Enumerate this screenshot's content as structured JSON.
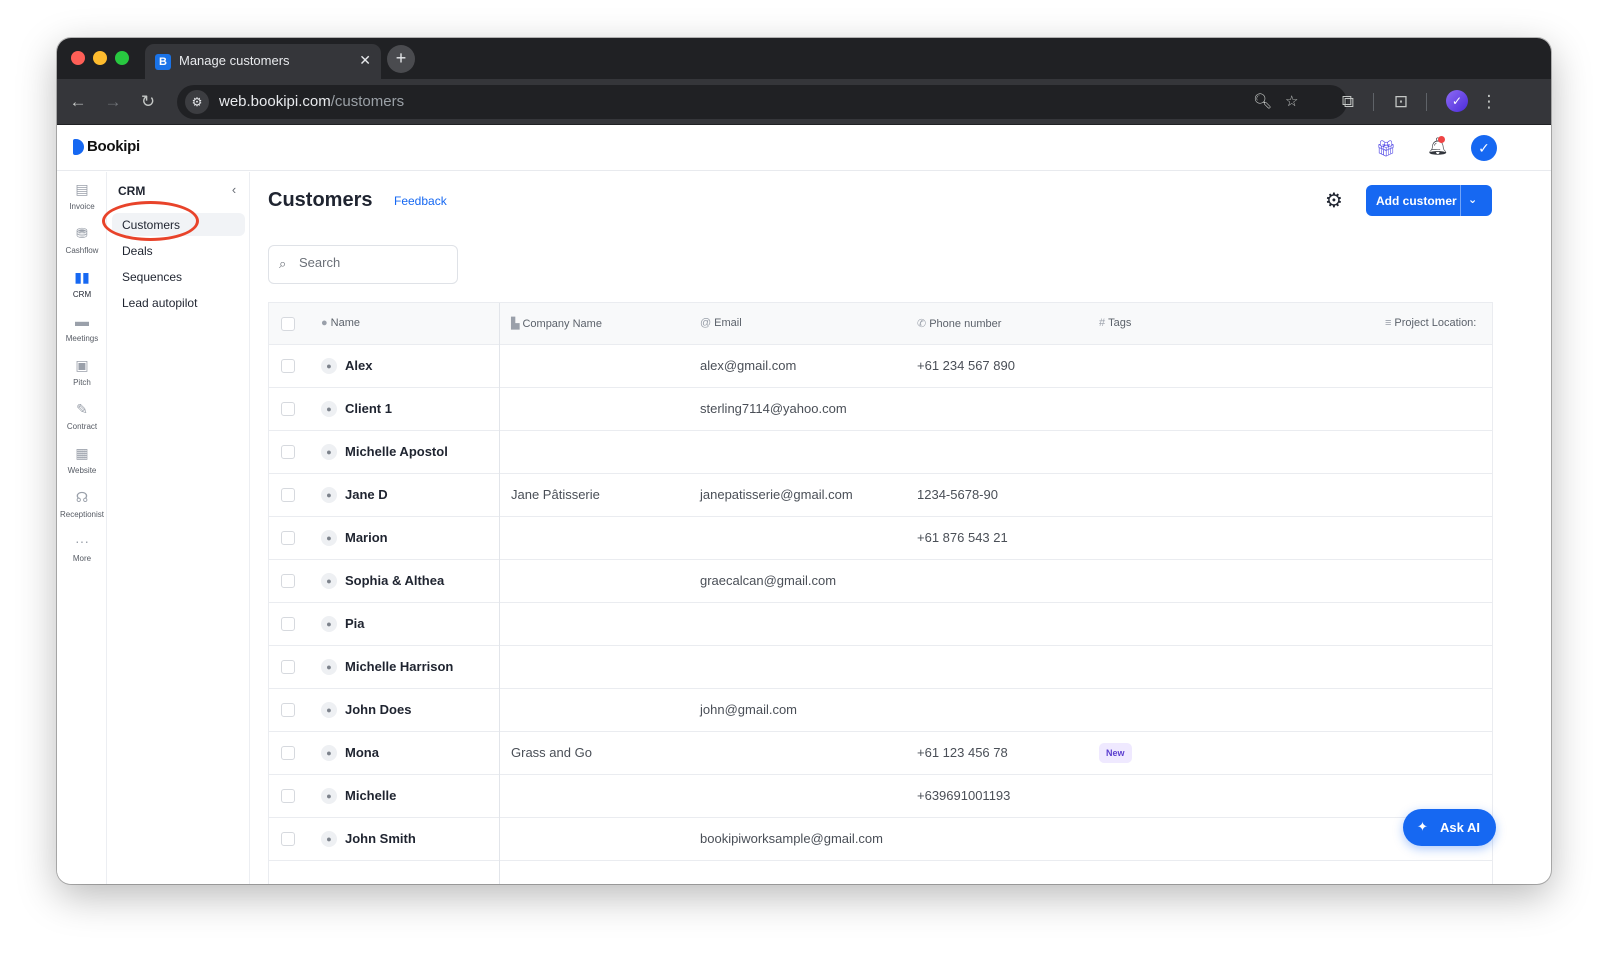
{
  "browser": {
    "tab_title": "Manage customers",
    "tab_favicon": "B",
    "url_domain": "web.bookipi.com",
    "url_path": "/customers"
  },
  "app": {
    "brand": "Bookipi"
  },
  "rail": [
    {
      "label": "Invoice",
      "icon": "invoice-icon",
      "glyph": "▤"
    },
    {
      "label": "Cashflow",
      "icon": "cashflow-icon",
      "glyph": "⛃"
    },
    {
      "label": "CRM",
      "icon": "crm-icon",
      "glyph": "▮▮",
      "active": true
    },
    {
      "label": "Meetings",
      "icon": "meetings-icon",
      "glyph": "▬"
    },
    {
      "label": "Pitch",
      "icon": "pitch-icon",
      "glyph": "▣"
    },
    {
      "label": "Contract",
      "icon": "contract-icon",
      "glyph": "✎"
    },
    {
      "label": "Website",
      "icon": "website-icon",
      "glyph": "▦"
    },
    {
      "label": "Receptionist",
      "icon": "headset-icon",
      "glyph": "☊"
    },
    {
      "label": "More",
      "icon": "more-icon",
      "glyph": "···"
    }
  ],
  "submenu": {
    "title": "CRM",
    "items": [
      "Customers",
      "Deals",
      "Sequences",
      "Lead autopilot"
    ],
    "active": "Customers"
  },
  "main": {
    "title": "Customers",
    "feedback": "Feedback",
    "add_button": "Add customer",
    "search_placeholder": "Search"
  },
  "table": {
    "columns": [
      {
        "label": "Name",
        "icon": "person-icon",
        "glyph": "👤"
      },
      {
        "label": "Company Name",
        "icon": "building-icon",
        "glyph": "▙"
      },
      {
        "label": "Email",
        "icon": "at-icon",
        "glyph": "@"
      },
      {
        "label": "Phone number",
        "icon": "phone-icon",
        "glyph": "✆"
      },
      {
        "label": "Tags",
        "icon": "hash-icon",
        "glyph": "#"
      },
      {
        "label": "Project Location:",
        "icon": "lines-icon",
        "glyph": "≡"
      }
    ],
    "rows": [
      {
        "name": "Alex",
        "company": "",
        "email": "alex@gmail.com",
        "phone": "+61 234 567 890",
        "tag": ""
      },
      {
        "name": "Client 1",
        "company": "",
        "email": "sterling7114@yahoo.com",
        "phone": "",
        "tag": ""
      },
      {
        "name": "Michelle Apostol",
        "company": "",
        "email": "",
        "phone": "",
        "tag": ""
      },
      {
        "name": "Jane D",
        "company": "Jane Pâtisserie",
        "email": "janepatisserie@gmail.com",
        "phone": "1234-5678-90",
        "tag": ""
      },
      {
        "name": "Marion",
        "company": "",
        "email": "",
        "phone": "+61 876 543 21",
        "tag": ""
      },
      {
        "name": "Sophia & Althea",
        "company": "",
        "email": "graecalcan@gmail.com",
        "phone": "",
        "tag": ""
      },
      {
        "name": "Pia",
        "company": "",
        "email": "",
        "phone": "",
        "tag": ""
      },
      {
        "name": "Michelle Harrison",
        "company": "",
        "email": "",
        "phone": "",
        "tag": ""
      },
      {
        "name": "John Does",
        "company": "",
        "email": "john@gmail.com",
        "phone": "",
        "tag": ""
      },
      {
        "name": "Mona",
        "company": "Grass and Go",
        "email": "",
        "phone": "+61 123 456 78",
        "tag": "New"
      },
      {
        "name": "Michelle",
        "company": "",
        "email": "",
        "phone": "+639691001193",
        "tag": ""
      },
      {
        "name": "John Smith",
        "company": "",
        "email": "bookipiworksample@gmail.com",
        "phone": "",
        "tag": ""
      }
    ]
  },
  "ask_ai": "Ask AI",
  "colors": {
    "accent": "#1668f2",
    "annotation": "#e8432a",
    "tag_bg": "#efe9ff"
  }
}
